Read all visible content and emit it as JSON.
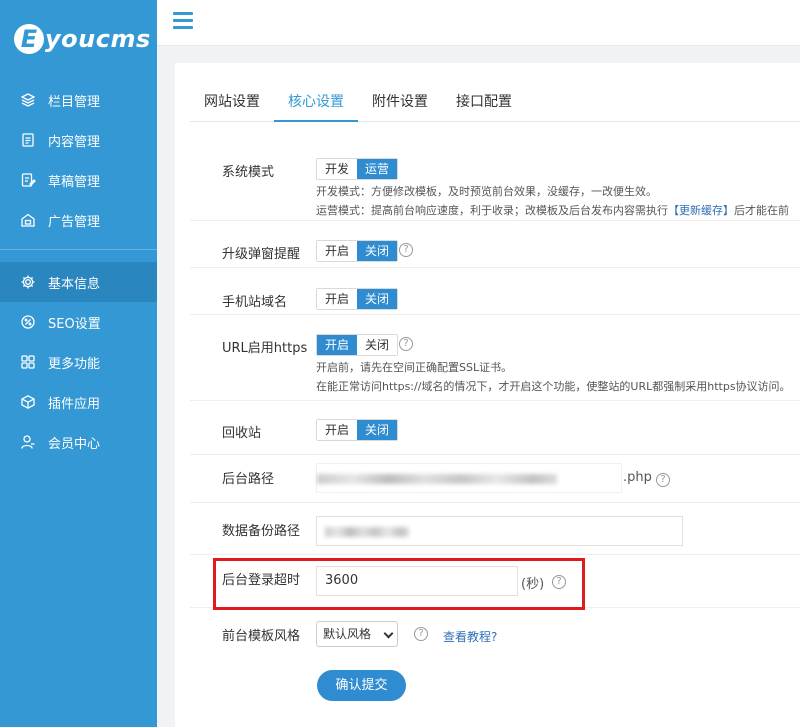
{
  "brand": {
    "logo_letter": "E",
    "logo_text": "youcms",
    "color": "#3498d4"
  },
  "sidebar": {
    "items": [
      {
        "label": "栏目管理",
        "icon": "layers-icon"
      },
      {
        "label": "内容管理",
        "icon": "document-icon"
      },
      {
        "label": "草稿管理",
        "icon": "draft-icon"
      },
      {
        "label": "广告管理",
        "icon": "ad-icon"
      },
      {
        "label": "基本信息",
        "icon": "gear-icon",
        "active": true
      },
      {
        "label": "SEO设置",
        "icon": "seo-icon"
      },
      {
        "label": "更多功能",
        "icon": "grid-icon"
      },
      {
        "label": "插件应用",
        "icon": "cube-icon"
      },
      {
        "label": "会员中心",
        "icon": "user-icon"
      }
    ]
  },
  "tabs": [
    {
      "label": "网站设置"
    },
    {
      "label": "核心设置",
      "active": true
    },
    {
      "label": "附件设置"
    },
    {
      "label": "接口配置"
    }
  ],
  "settings": {
    "system_mode": {
      "label": "系统模式",
      "options": [
        "开发",
        "运营"
      ],
      "selected": "运营",
      "note1": "开发模式：方便修改模板，及时预览前台效果，没缓存，一改便生效。",
      "note2_pre": "运营模式：提高前台响应速度，利于收录；改模板及后台发布内容需执行",
      "note2_link": "【更新缓存】",
      "note2_post": "后才能在前"
    },
    "upgrade_popup": {
      "label": "升级弹窗提醒",
      "options": [
        "开启",
        "关闭"
      ],
      "selected": "关闭"
    },
    "mobile_domain": {
      "label": "手机站域名",
      "options": [
        "开启",
        "关闭"
      ],
      "selected": "关闭"
    },
    "url_https": {
      "label": "URL启用https",
      "options": [
        "开启",
        "关闭"
      ],
      "selected": "开启",
      "note1": "开启前，请先在空间正确配置SSL证书。",
      "note2": "在能正常访问https://域名的情况下，才开启这个功能，使整站的URL都强制采用https协议访问。"
    },
    "recycle_bin": {
      "label": "回收站",
      "options": [
        "开启",
        "关闭"
      ],
      "selected": "关闭"
    },
    "admin_path": {
      "label": "后台路径",
      "suffix": ".php"
    },
    "backup_path": {
      "label": "数据备份路径"
    },
    "login_timeout": {
      "label": "后台登录超时",
      "value": "3600",
      "unit": "(秒)"
    },
    "template_style": {
      "label": "前台模板风格",
      "selected": "默认风格",
      "help_link": "查看教程?"
    }
  },
  "submit_label": "确认提交",
  "help_glyph": "?",
  "colors": {
    "primary": "#2f8cd0",
    "highlight": "#e01a1a"
  }
}
